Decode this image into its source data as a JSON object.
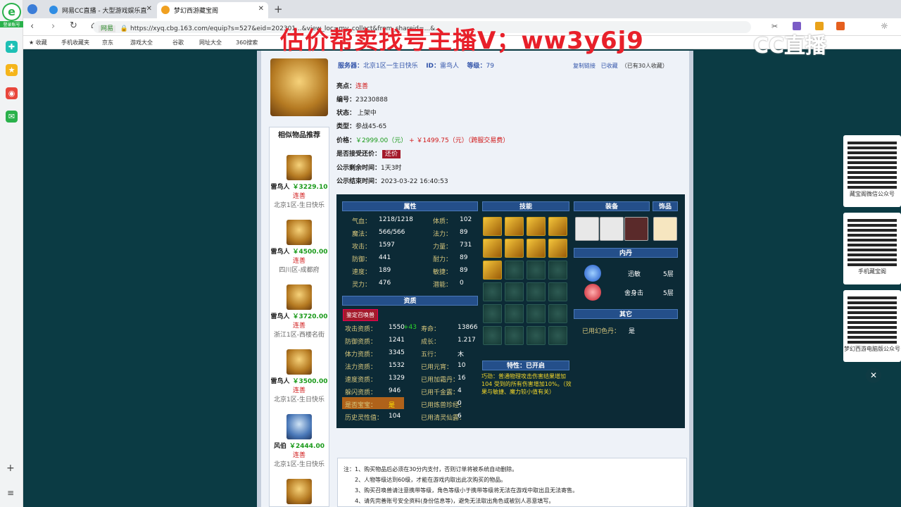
{
  "rail": {
    "login_label": "登录账号"
  },
  "tabs": [
    {
      "label": "网易CC直播 - 大型游戏娱乐直"
    },
    {
      "label": "梦幻西游藏宝阁"
    }
  ],
  "address": {
    "site_label": "网易",
    "url": "https://xyq.cbg.163.com/equip?s=527&eid=202301...&view_loc=my_collect&from_shareid=...&..."
  },
  "bookmarks": [
    "收藏",
    "手机收藏夹",
    "京东",
    "游戏大全",
    "谷歌",
    "网址大全",
    "360搜索"
  ],
  "overlay_text": "估价帮卖找号主播V；ww3y6j9",
  "cc_logo": "CC直播",
  "header": {
    "server_label": "服务器：",
    "server": "北京1区一生日快乐",
    "id_label": "ID：",
    "id": "雷鸟人",
    "level_label": "等级：",
    "level": "79",
    "copy_link": "复制链接",
    "collected": "已收藏",
    "collect_count": "（已有30人收藏）"
  },
  "info": {
    "highlight_label": "亮点：",
    "highlight": "连善",
    "code_label": "编号：",
    "code": "23230888",
    "status_label": "状态：",
    "status": "上架中",
    "type_label": "类型：",
    "type": "参战45-65",
    "price_label": "价格：",
    "price": "￥2999.00（元）",
    "plus": "+",
    "fee": "￥1499.75（元）（跨服交易费）",
    "bargain_label": "是否接受还价：",
    "bargain_btn": "还价",
    "remain_label": "公示剩余时间：",
    "remain": "1天3时",
    "end_label": "公示结束时间：",
    "end": "2023-03-22 16:40:53"
  },
  "similar": {
    "title": "相似物品推荐",
    "items": [
      {
        "name": "雷鸟人",
        "price": "￥3229.10",
        "tag": "连善",
        "server": "北京1区-生日快乐"
      },
      {
        "name": "雷鸟人",
        "price": "￥4500.00",
        "tag": "连善",
        "server": "四川区-成都府"
      },
      {
        "name": "雷鸟人",
        "price": "￥3720.00",
        "tag": "连善",
        "server": "浙江1区-西楼名街"
      },
      {
        "name": "雷鸟人",
        "price": "￥3500.00",
        "tag": "连善",
        "server": "北京1区-生日快乐"
      },
      {
        "name": "风伯",
        "price": "￥2444.00",
        "tag": "连善",
        "server": "北京1区-生日快乐"
      }
    ]
  },
  "panel": {
    "h_attr": "属性",
    "h_skill": "技能",
    "h_equip": "装备",
    "h_deco": "饰品",
    "h_neidan": "内丹",
    "h_other": "其它",
    "h_zizhi": "资质",
    "h_trait": "特性：已开启",
    "attrs": [
      [
        "气血：",
        "1218/1218",
        "体质：",
        "102"
      ],
      [
        "魔法：",
        "566/566",
        "法力：",
        "89"
      ],
      [
        "攻击：",
        "1597",
        "力量：",
        "731"
      ],
      [
        "防御：",
        "441",
        "耐力：",
        "89"
      ],
      [
        "速度：",
        "189",
        "敏捷：",
        "89"
      ],
      [
        "灵力：",
        "476",
        "潜能：",
        "0"
      ]
    ],
    "identify_btn": "鉴定召唤兽",
    "zizhi": [
      [
        "攻击资质：",
        "1550",
        "+43",
        "寿命：",
        "13866"
      ],
      [
        "防御资质：",
        "1241",
        "",
        "成长：",
        "1.217"
      ],
      [
        "体力资质：",
        "3345",
        "",
        "五行：",
        "木"
      ],
      [
        "法力资质：",
        "1532",
        "",
        "已用元宵：",
        "10"
      ],
      [
        "速度资质：",
        "1329",
        "",
        "已用加霜丹：",
        "16"
      ],
      [
        "躲闪资质：",
        "946",
        "",
        "已用千金露：",
        "4"
      ],
      [
        "是否宝宝：",
        "是",
        "",
        "已用炼兽珍经：",
        "0"
      ],
      [
        "历史灵性值：",
        "104",
        "",
        "已用清灵仙露：",
        "6"
      ]
    ],
    "neidan": [
      {
        "name": "迅敏",
        "level": "5层"
      },
      {
        "name": "舍身击",
        "level": "5层"
      }
    ],
    "other_label": "已用幻色丹：",
    "other_value": "是",
    "trait_text": "巧劲：普通物理攻击伤害结果增加104 受到的所有伤害增加10%。（效果与敏捷、魔力较小值有关）"
  },
  "notes": [
    "注：1、购买物品后必须在30分内支付，否则订单将被系统自动删除。",
    "2、人物等级达到60级，才能在游戏内取出此次购买的物品。",
    "3、购买召唤兽请注意携带等级，角色等级小于携带等级将无法在游戏中取出且无法寄售。",
    "4、请先完善账号安全资料(身份信息等)，避免无法取出角色或被别人恶意填写。"
  ],
  "qr": [
    {
      "label": "藏宝阁微信公众号"
    },
    {
      "label": "手机藏宝阁"
    },
    {
      "label": "梦幻西游电脑版公众号"
    }
  ]
}
